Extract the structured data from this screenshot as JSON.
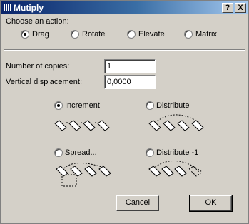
{
  "window": {
    "title": "Mutiply",
    "help_button": "?",
    "close_button": "X"
  },
  "action_group": {
    "label": "Choose an action:",
    "options": [
      {
        "label": "Drag",
        "selected": true
      },
      {
        "label": "Rotate",
        "selected": false
      },
      {
        "label": "Elevate",
        "selected": false
      },
      {
        "label": "Matrix",
        "selected": false
      }
    ]
  },
  "fields": {
    "copies_label": "Number of copies:",
    "copies_value": "1",
    "displacement_label": "Vertical displacement:",
    "displacement_value": "0,0000"
  },
  "distribution": [
    {
      "label": "Increment",
      "selected": true
    },
    {
      "label": "Distribute",
      "selected": false
    },
    {
      "label": "Spread...",
      "selected": false
    },
    {
      "label": "Distribute -1",
      "selected": false
    }
  ],
  "buttons": {
    "cancel": "Cancel",
    "ok": "OK"
  }
}
